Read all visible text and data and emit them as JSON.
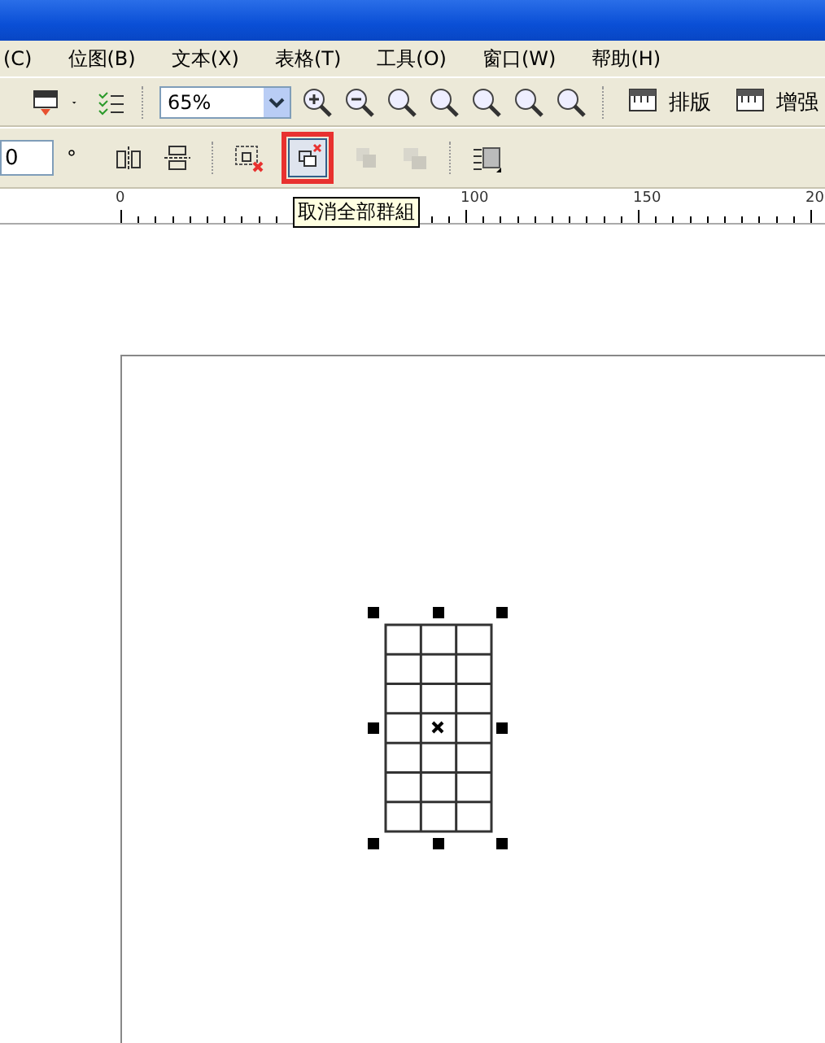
{
  "menu_bar": [
    {
      "label": "(C)"
    },
    {
      "label": "位图(B)"
    },
    {
      "label": "文本(X)"
    },
    {
      "label": "表格(T)"
    },
    {
      "label": "工具(O)"
    },
    {
      "label": "窗口(W)"
    },
    {
      "label": "帮助(H)"
    }
  ],
  "standard_toolbar": {
    "zoom_level": "65%",
    "layout_button": "排版",
    "enhance_button": "增强"
  },
  "property_bar": {
    "angle_value": "0",
    "angle_unit": "°",
    "buttons": [
      {
        "kind": "mirror-h",
        "disabled": false,
        "highlighted": false
      },
      {
        "kind": "mirror-v",
        "disabled": false,
        "highlighted": false
      },
      {
        "kind": "ungroup",
        "disabled": false,
        "highlighted": false
      },
      {
        "kind": "ungroup-all",
        "disabled": false,
        "highlighted": true
      },
      {
        "kind": "combine",
        "disabled": true,
        "highlighted": false
      },
      {
        "kind": "break",
        "disabled": true,
        "highlighted": false
      },
      {
        "kind": "wrap",
        "disabled": false,
        "highlighted": false
      }
    ]
  },
  "tooltip": "取消全部群組",
  "ruler": {
    "labels": [
      "0",
      "100",
      "150",
      "20"
    ]
  },
  "canvas": {
    "table": {
      "selected": true
    }
  }
}
